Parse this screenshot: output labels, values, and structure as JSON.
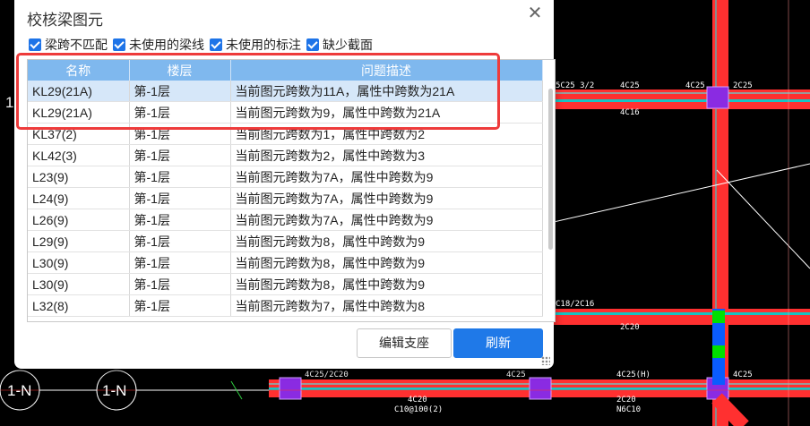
{
  "dialog": {
    "title": "校核梁图元",
    "close_label": "✕",
    "filters": [
      {
        "label": "梁跨不匹配",
        "checked": true
      },
      {
        "label": "未使用的梁线",
        "checked": true
      },
      {
        "label": "未使用的标注",
        "checked": true
      },
      {
        "label": "缺少截面",
        "checked": true
      }
    ],
    "table": {
      "headers": [
        "名称",
        "楼层",
        "问题描述"
      ],
      "rows": [
        {
          "name": "KL29(21A)",
          "floor": "第-1层",
          "desc": "当前图元跨数为11A，属性中跨数为21A"
        },
        {
          "name": "KL29(21A)",
          "floor": "第-1层",
          "desc": "当前图元跨数为9，属性中跨数为21A"
        },
        {
          "name": "KL37(2)",
          "floor": "第-1层",
          "desc": "当前图元跨数为1，属性中跨数为2"
        },
        {
          "name": "KL42(3)",
          "floor": "第-1层",
          "desc": "当前图元跨数为2，属性中跨数为3"
        },
        {
          "name": "L23(9)",
          "floor": "第-1层",
          "desc": "当前图元跨数为7A，属性中跨数为9"
        },
        {
          "name": "L24(9)",
          "floor": "第-1层",
          "desc": "当前图元跨数为7A，属性中跨数为9"
        },
        {
          "name": "L26(9)",
          "floor": "第-1层",
          "desc": "当前图元跨数为7A，属性中跨数为9"
        },
        {
          "name": "L29(9)",
          "floor": "第-1层",
          "desc": "当前图元跨数为8，属性中跨数为9"
        },
        {
          "name": "L30(9)",
          "floor": "第-1层",
          "desc": "当前图元跨数为8，属性中跨数为9"
        },
        {
          "name": "L30(9)",
          "floor": "第-1层",
          "desc": "当前图元跨数为8，属性中跨数为9"
        },
        {
          "name": "L32(8)",
          "floor": "第-1层",
          "desc": "当前图元跨数为7，属性中跨数为8"
        }
      ],
      "selected_index": 0
    },
    "buttons": {
      "edit_support": "编辑支座",
      "refresh": "刷新"
    }
  },
  "cad": {
    "labels": [
      "5C25 3/2",
      "4C25",
      "4C25",
      "2C25",
      "4C16",
      "C18/2C16",
      "2C20",
      "4C25/2C20",
      "4C25",
      "4C25(H)",
      "4C20",
      "C10@100(2)",
      "2C20",
      "N6C10",
      "4C25"
    ],
    "axis_labels": [
      "1-N",
      "1-N",
      "1"
    ]
  },
  "colors": {
    "accent": "#1f79e8",
    "header": "#7fb8ee",
    "highlight": "#ee3b3b",
    "beam": "#ff3030"
  }
}
